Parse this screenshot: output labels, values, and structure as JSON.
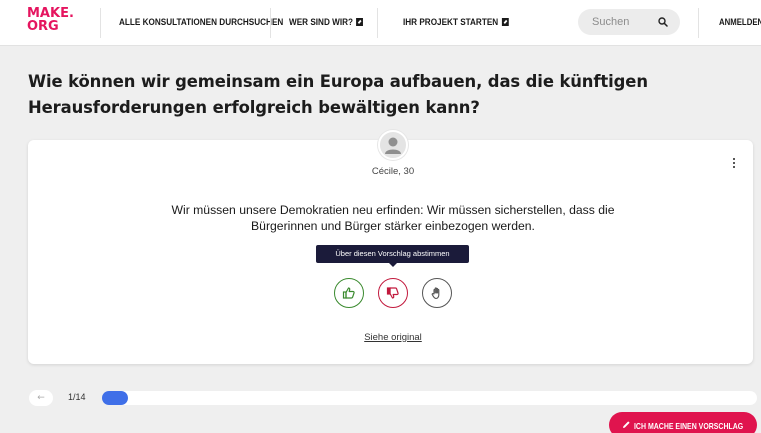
{
  "header": {
    "logo_line1": "MAKE.",
    "logo_line2": "ORG",
    "nav": [
      {
        "label": "ALLE KONSULTATIONEN DURCHSUCHEN",
        "external": false
      },
      {
        "label": "WER SIND WIR?",
        "external": true
      },
      {
        "label": "IHR PROJEKT STARTEN",
        "external": true
      }
    ],
    "search_placeholder": "Suchen",
    "login_label": "ANMELDEN"
  },
  "question": "Wie können wir gemeinsam ein Europa aufbauen, das die künftigen Herausforderungen erfolgreich bewältigen kann?",
  "proposal": {
    "author": "Cécile, 30",
    "text_line1": "Wir müssen unsere Demokratien neu erfinden: Wir müssen sicherstellen, dass die",
    "text_line2": "Bürgerinnen und Bürger stärker einbezogen werden.",
    "tooltip": "Über diesen Vorschlag abstimmen",
    "see_original": "Siehe original",
    "votes": [
      {
        "name": "agree",
        "icon": "thumbs-up-icon",
        "color": "#3a8a2e"
      },
      {
        "name": "disagree",
        "icon": "thumbs-down-icon",
        "color": "#c2193d"
      },
      {
        "name": "neutral",
        "icon": "hand-neutral-icon",
        "color": "#555555"
      }
    ]
  },
  "progress": {
    "counter": "1/14",
    "current": 1,
    "total": 14,
    "color": "#3f6fe8"
  },
  "cta_label": "ICH MACHE EINEN VORSCHLAG",
  "colors": {
    "brand": "#e5155f",
    "cta": "#e0144e",
    "agree": "#3a8a2e",
    "disagree": "#c2193d",
    "tooltip_bg": "#1b1b3a"
  }
}
